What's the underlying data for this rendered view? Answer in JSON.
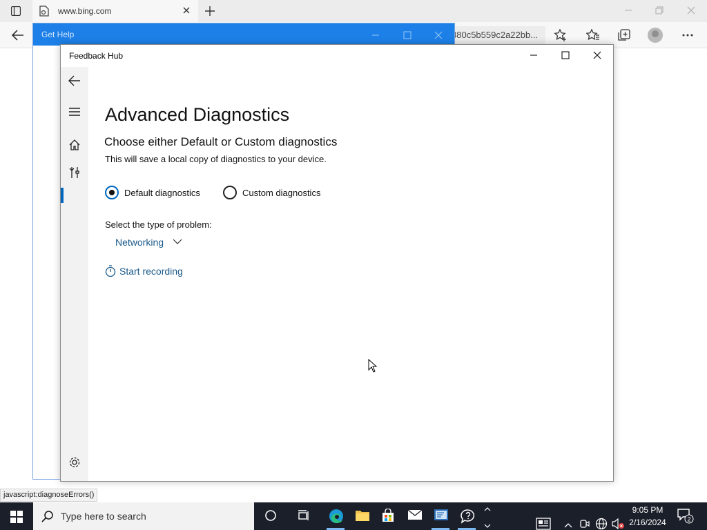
{
  "browser": {
    "tab_title": "www.bing.com",
    "address_fragment": "380c5b559c2a22bb..."
  },
  "gethelp": {
    "title": "Get Help"
  },
  "feedback_hub": {
    "title": "Feedback Hub",
    "heading": "Advanced Diagnostics",
    "subheading": "Choose either Default or Custom diagnostics",
    "description": "This will save a local copy of diagnostics to your device.",
    "radios": [
      {
        "label": "Default diagnostics",
        "checked": true
      },
      {
        "label": "Custom diagnostics",
        "checked": false
      }
    ],
    "problem_label": "Select the type of problem:",
    "problem_value": "Networking",
    "record_label": "Start recording",
    "accent": "#0067c0"
  },
  "status_text": "javascript:diagnoseErrors()",
  "taskbar": {
    "search_placeholder": "Type here to search",
    "time": "9:05 PM",
    "date": "2/16/2024",
    "notification_count": "2"
  }
}
